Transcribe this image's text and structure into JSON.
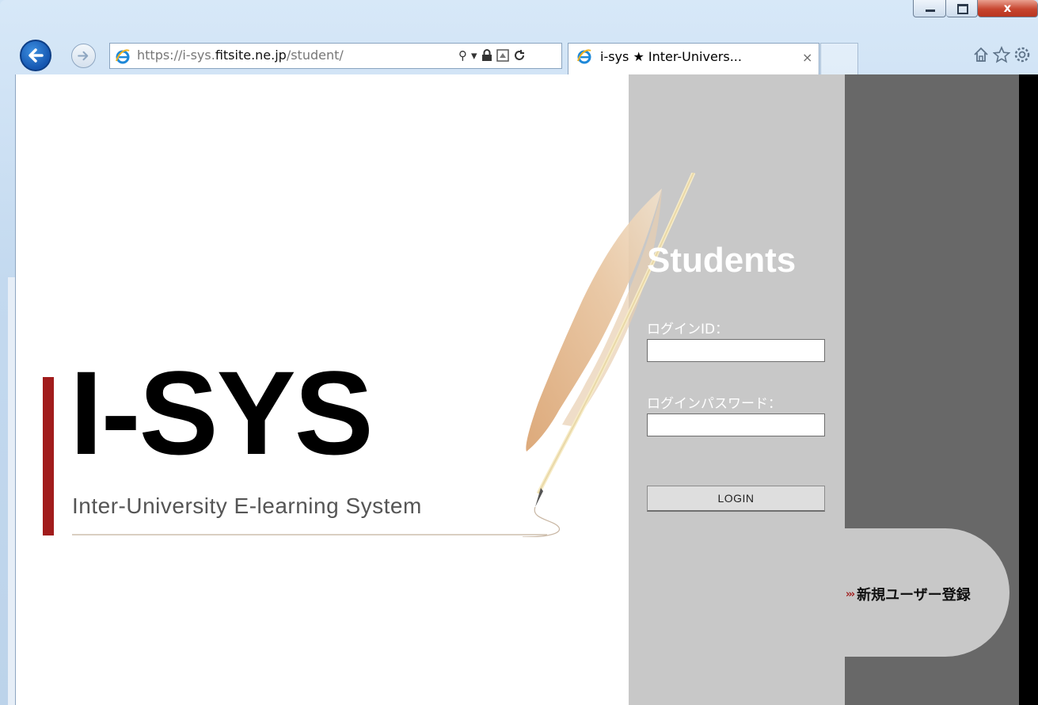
{
  "browser": {
    "url_prefix": "https://",
    "url_host_dim": "i-sys.",
    "url_host_dark": "fitsite.ne.jp",
    "url_path": "/student/",
    "tab_title": "i-sys  ★  Inter-Univers...",
    "tab_close": "×",
    "close_glyph": "x"
  },
  "page": {
    "logo": "I-SYS",
    "tagline": "Inter-University E-learning System",
    "heading": "Students",
    "login_id_label": "ログインID：",
    "password_label": "ログインパスワード：",
    "login_button": "LOGIN",
    "register_arrow": "›››",
    "register_label": "新規ユーザー登録"
  },
  "colors": {
    "accent_red": "#a11c1c",
    "panel_gray": "#c8c8c8",
    "panel_dark": "#686868"
  },
  "icons": [
    "back-icon",
    "forward-icon",
    "ie-icon",
    "search-icon",
    "dropdown-icon",
    "lock-icon",
    "compat-icon",
    "refresh-icon",
    "home-icon",
    "favorites-icon",
    "settings-icon",
    "feather-icon"
  ]
}
